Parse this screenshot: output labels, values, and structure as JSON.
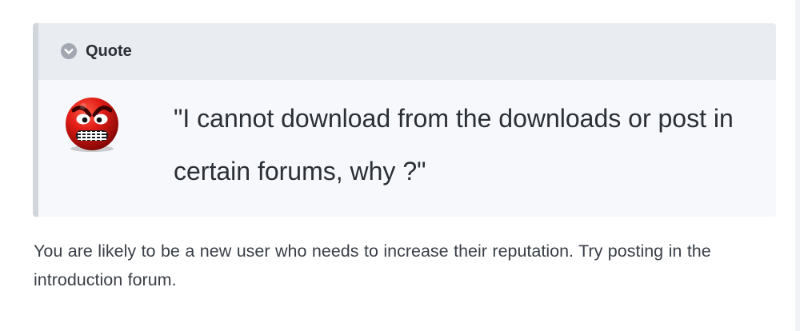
{
  "quote": {
    "header_label": "Quote",
    "toggle_icon": "chevron-down-circle-icon",
    "avatar_icon": "angry-smiley-icon",
    "text": "\"I cannot download from the downloads or post in certain forums, why ?\""
  },
  "reply": {
    "text": "You are likely to be a new user who needs to increase their reputation.  Try posting in the introduction forum."
  },
  "colors": {
    "quote_background": "#f6f8fb",
    "quote_header_background": "#e9ecf1",
    "quote_border": "#d1d5dc",
    "text_dark": "#2b2f36",
    "text_body": "#3a3f47",
    "toggle_icon": "#a2a7b0",
    "avatar_red": "#d01812"
  }
}
